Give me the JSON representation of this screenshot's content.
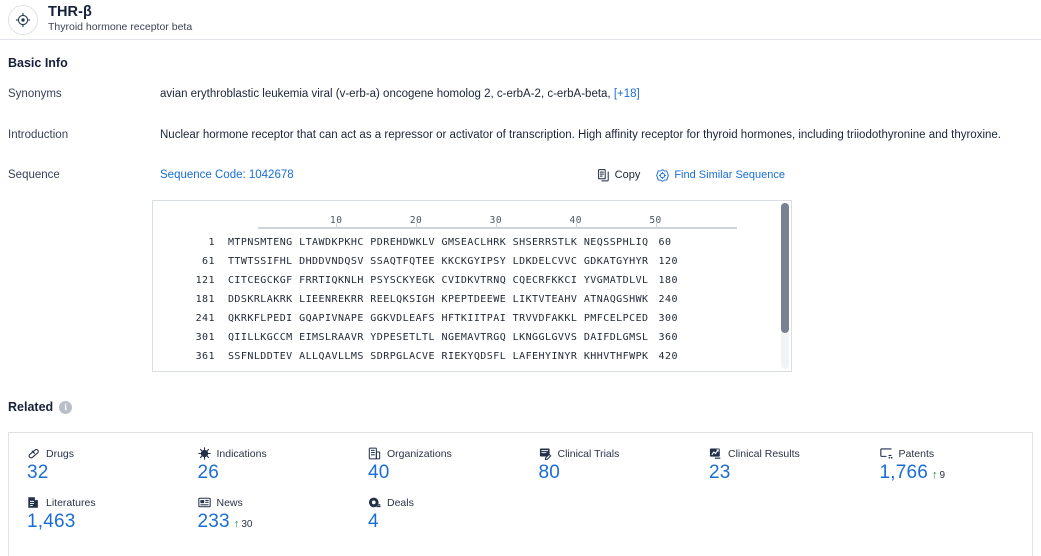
{
  "header": {
    "icon": "target-icon",
    "title": "THR-β",
    "subtitle": "Thyroid hormone receptor beta"
  },
  "basic_info": {
    "section_title": "Basic Info",
    "rows": {
      "synonyms": {
        "label": "Synonyms",
        "value": "avian erythroblastic leukemia viral (v-erb-a) oncogene homolog 2,  c-erbA-2,  c-erbA-beta,",
        "more_link": "[+18]"
      },
      "introduction": {
        "label": "Introduction",
        "value": "Nuclear hormone receptor that can act as a repressor or activator of transcription. High affinity receptor for thyroid hormones, including triiodothyronine and thyroxine."
      },
      "sequence": {
        "label": "Sequence",
        "code_text": "Sequence Code: 1042678",
        "copy_label": "Copy",
        "copy_icon": "copy-icon",
        "find_similar_label": "Find Similar Sequence",
        "find_similar_icon": "find-similar-icon"
      }
    }
  },
  "sequence_viewer": {
    "ruler_ticks": [
      10,
      20,
      30,
      40,
      50
    ],
    "lines": [
      {
        "start": "1",
        "blocks": "MTPNSMTENG LTAWDKPKHC PDREHDWKLV GMSEACLHRK SHSERRSTLK NEQSSPHLIQ",
        "end": "60"
      },
      {
        "start": "61",
        "blocks": "TTWTSSIFHL DHDDVNDQSV SSAQTFQTEE KKCKGYIPSY LDKDELCVVC GDKATGYHYR",
        "end": "120"
      },
      {
        "start": "121",
        "blocks": "CITCEGCKGF FRRTIQKNLH PSYSCKYEGK CVIDKVTRNQ CQECRFKKCI YVGMATDLVL",
        "end": "180"
      },
      {
        "start": "181",
        "blocks": "DDSKRLAKRK LIEENREKRR REELQKSIGH KPEPTDEEWE LIKTVTEAHV ATNAQGSHWK",
        "end": "240"
      },
      {
        "start": "241",
        "blocks": "QKRKFLPEDI GQAPIVNAPE GGKVDLEAFS HFTKIITPAI TRVVDFAKKL PMFCELPCED",
        "end": "300"
      },
      {
        "start": "301",
        "blocks": "QIILLKGCCM EIMSLRAAVR YDPESETLTL NGEMAVTRGQ LKNGGLGVVS DAIFDLGMSL",
        "end": "360"
      },
      {
        "start": "361",
        "blocks": "SSFNLDDTEV ALLQAVLLMS SDRPGLACVE RIEKYQDSFL LAFEHYINYR KHHVTHFWPK",
        "end": "420"
      }
    ]
  },
  "related": {
    "title": "Related",
    "info_icon": "info-icon",
    "stats": [
      {
        "icon": "pill-icon",
        "label": "Drugs",
        "value": "32",
        "delta": null
      },
      {
        "icon": "virus-icon",
        "label": "Indications",
        "value": "26",
        "delta": null
      },
      {
        "icon": "organization-icon",
        "label": "Organizations",
        "value": "40",
        "delta": null
      },
      {
        "icon": "clinical-trial-icon",
        "label": "Clinical Trials",
        "value": "80",
        "delta": null
      },
      {
        "icon": "clinical-result-icon",
        "label": "Clinical Results",
        "value": "23",
        "delta": null
      },
      {
        "icon": "patent-icon",
        "label": "Patents",
        "value": "1,766",
        "delta": "9"
      },
      {
        "icon": "literature-icon",
        "label": "Literatures",
        "value": "1,463",
        "delta": null
      },
      {
        "icon": "news-icon",
        "label": "News",
        "value": "233",
        "delta": "30"
      },
      {
        "icon": "deal-icon",
        "label": "Deals",
        "value": "4",
        "delta": null
      }
    ]
  },
  "colors": {
    "link_blue": "#1a6dd4",
    "text_dark": "#1b2538",
    "delta_green": "#1f8a3b",
    "border": "#dfe3e9"
  }
}
